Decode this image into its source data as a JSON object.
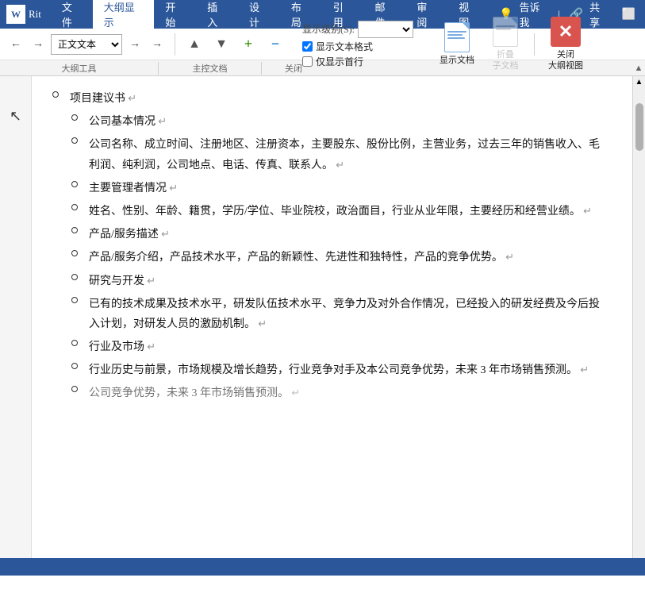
{
  "titlebar": {
    "app_icon": "W",
    "doc_name": "Rit",
    "tabs": [
      {
        "label": "文件",
        "active": false
      },
      {
        "label": "大纲显示",
        "active": true
      },
      {
        "label": "开始",
        "active": false
      },
      {
        "label": "插入",
        "active": false
      },
      {
        "label": "设计",
        "active": false
      },
      {
        "label": "布局",
        "active": false
      },
      {
        "label": "引用",
        "active": false
      },
      {
        "label": "邮件",
        "active": false
      },
      {
        "label": "审阅",
        "active": false
      },
      {
        "label": "视图",
        "active": false
      }
    ],
    "tell_me": "告诉我",
    "share": "共享"
  },
  "ribbon": {
    "level_label": "显示级别(S):",
    "show_text_format": "显示文本格式",
    "show_first_line_only": "仅显示首行",
    "nav_prev": "←",
    "nav_next": "→",
    "style_dropdown": "正文文本",
    "promote_label": "▲",
    "demote_label": "▼",
    "move_up_label": "+",
    "move_down_label": "−",
    "outline_tools_label": "大纲工具",
    "show_doc_label": "显示文档",
    "fold_subdoc_label": "折叠\n子文档",
    "close_outline_label": "关闭\n大纲视图",
    "master_doc_label": "主控文档",
    "close_label": "关闭"
  },
  "content": {
    "items": [
      {
        "level": 1,
        "text": "项目建议书",
        "has_mark": true
      },
      {
        "level": 2,
        "text": "公司基本情况",
        "has_mark": true
      },
      {
        "level": 2,
        "text": "公司名称、成立时间、注册地区、注册资本，主要股东、股份比例，主营业务，过去三年的销售收入、毛利润、纯利润，公司地点、电话、传真、联系人。",
        "has_mark": true
      },
      {
        "level": 2,
        "text": "主要管理者情况",
        "has_mark": true
      },
      {
        "level": 2,
        "text": "姓名、性别、年龄、籍贯，学历/学位、毕业院校，政治面目，行业从业年限，主要经历和经营业绩。",
        "has_mark": true
      },
      {
        "level": 2,
        "text": "产品/服务描述",
        "has_mark": true
      },
      {
        "level": 2,
        "text": "产品/服务介绍，产品技术水平，产品的新颖性、先进性和独特性，产品的竞争优势。",
        "has_mark": true
      },
      {
        "level": 2,
        "text": "研究与开发",
        "has_mark": true
      },
      {
        "level": 2,
        "text": "已有的技术成果及技术水平，研发队伍技术水平、竞争力及对外合作情况，已经投入的研发经费及今后投入计划，对研发人员的激励机制。",
        "has_mark": true
      },
      {
        "level": 2,
        "text": "行业及市场",
        "has_mark": true
      },
      {
        "level": 2,
        "text": "行业历史与前景，市场规模及增长趋势，行业竞争对手及本公司竞争优势，未来 3 年市场销售预测。",
        "has_mark": true
      },
      {
        "level": 2,
        "text": "公司竞争优势，未来 3 年市场销售预测。",
        "has_mark": true,
        "partial": true
      }
    ]
  },
  "statusbar": {
    "page_info": "",
    "word_count": "",
    "lang": ""
  }
}
